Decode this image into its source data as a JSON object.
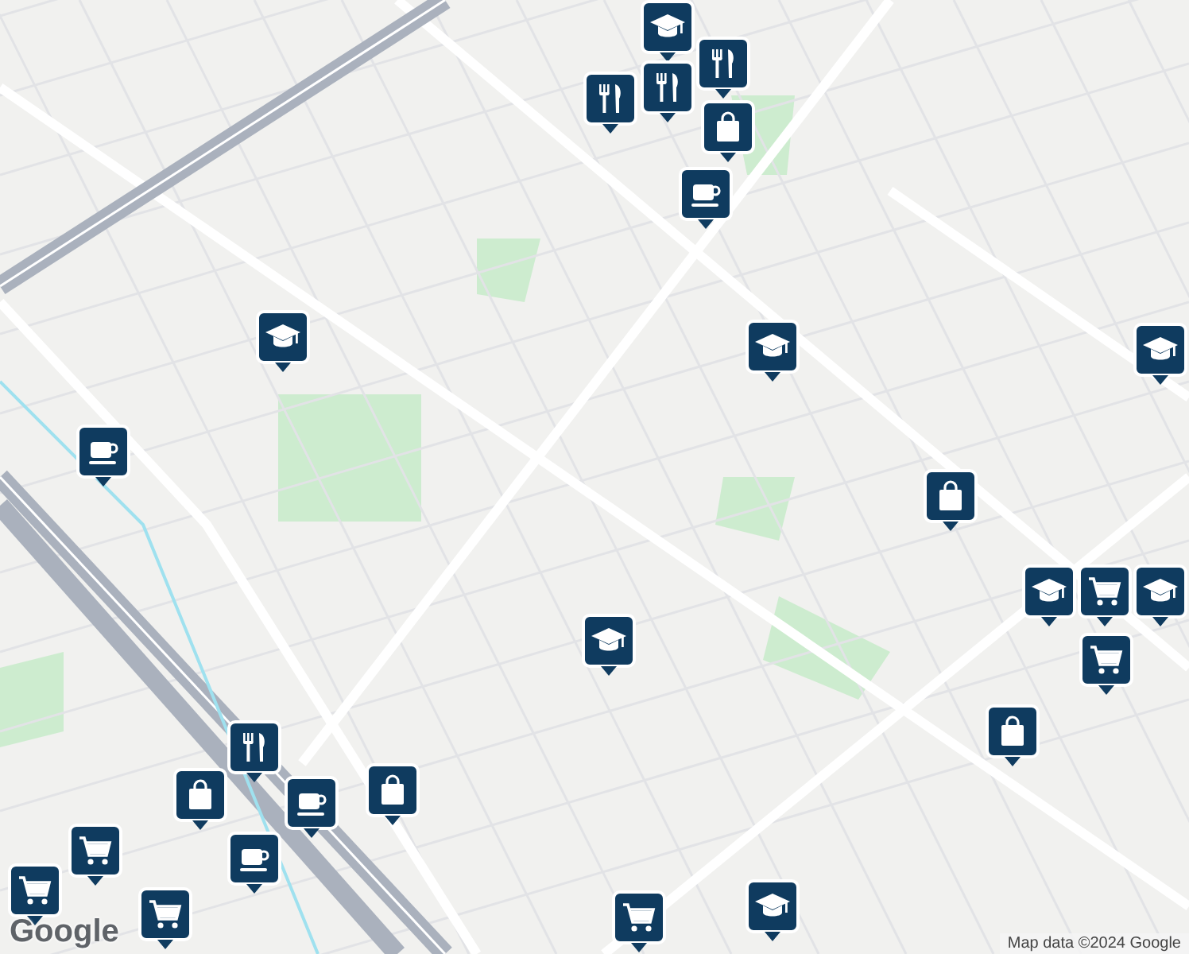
{
  "map": {
    "pins": [
      {
        "kind": "school"
      },
      {
        "kind": "restaurant"
      },
      {
        "kind": "restaurant"
      },
      {
        "kind": "restaurant"
      },
      {
        "kind": "shopping"
      },
      {
        "kind": "cafe"
      },
      {
        "kind": "school"
      },
      {
        "kind": "cafe"
      },
      {
        "kind": "school"
      },
      {
        "kind": "school"
      },
      {
        "kind": "shopping"
      },
      {
        "kind": "school"
      },
      {
        "kind": "grocery"
      },
      {
        "kind": "school"
      },
      {
        "kind": "grocery"
      },
      {
        "kind": "school"
      },
      {
        "kind": "shopping"
      },
      {
        "kind": "shopping"
      },
      {
        "kind": "restaurant"
      },
      {
        "kind": "shopping"
      },
      {
        "kind": "cafe"
      },
      {
        "kind": "grocery"
      },
      {
        "kind": "grocery"
      },
      {
        "kind": "cafe"
      },
      {
        "kind": "grocery"
      },
      {
        "kind": "grocery"
      },
      {
        "kind": "school"
      }
    ]
  },
  "logo": "Google",
  "attribution": "Map data ©2024 Google"
}
